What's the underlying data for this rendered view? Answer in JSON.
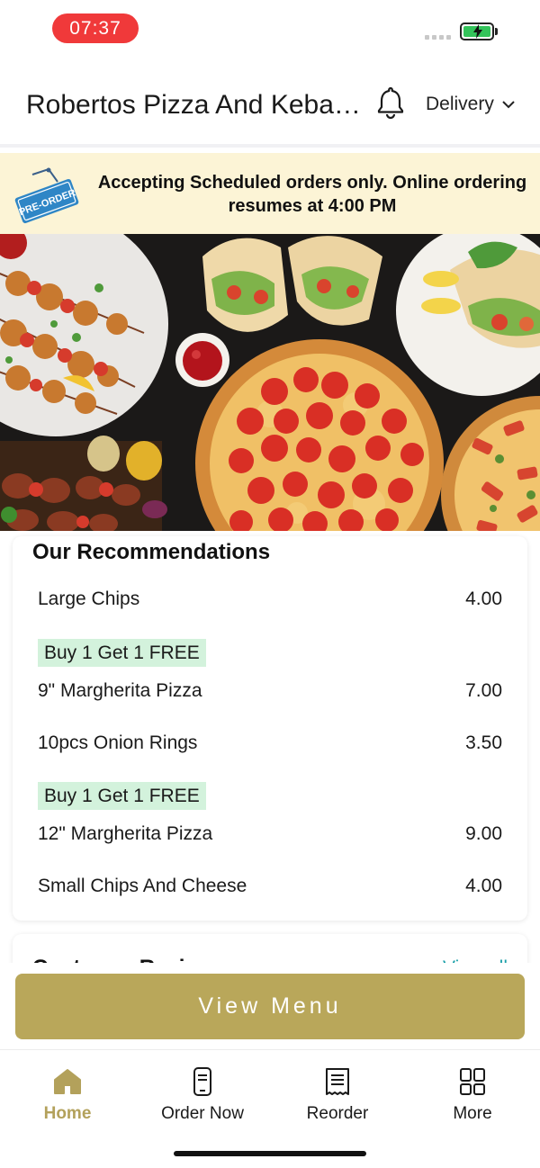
{
  "status_bar": {
    "time": "07:37"
  },
  "header": {
    "restaurant_name": "Robertos Pizza And Kebab House",
    "delivery_label": "Delivery"
  },
  "banner": {
    "tag_text": "PRE-ORDER",
    "message": "Accepting Scheduled orders only. Online ordering resumes at 4:00 PM"
  },
  "recommendations": {
    "title": "Our Recommendations",
    "items": [
      {
        "name": "Large Chips",
        "price": "4.00",
        "promo": ""
      },
      {
        "name": "9\" Margherita Pizza",
        "price": "7.00",
        "promo": "Buy 1 Get 1 FREE"
      },
      {
        "name": "10pcs Onion Rings",
        "price": "3.50",
        "promo": ""
      },
      {
        "name": "12\" Margherita Pizza",
        "price": "9.00",
        "promo": "Buy 1 Get 1 FREE"
      },
      {
        "name": "Small Chips And Cheese",
        "price": "4.00",
        "promo": ""
      }
    ]
  },
  "reviews_card": {
    "title": "Customer Reviews",
    "link": "View all"
  },
  "view_menu_label": "View Menu",
  "tabs": [
    {
      "label": "Home",
      "icon": "home-icon",
      "active": true
    },
    {
      "label": "Order Now",
      "icon": "order-now-icon",
      "active": false
    },
    {
      "label": "Reorder",
      "icon": "receipt-icon",
      "active": false
    },
    {
      "label": "More",
      "icon": "grid-icon",
      "active": false
    }
  ],
  "colors": {
    "accent": "#b9a75a",
    "banner_bg": "#fcf4d6",
    "promo_bg": "#d3f2dc",
    "time_pill": "#f0393a",
    "link": "#1a9fa8"
  }
}
